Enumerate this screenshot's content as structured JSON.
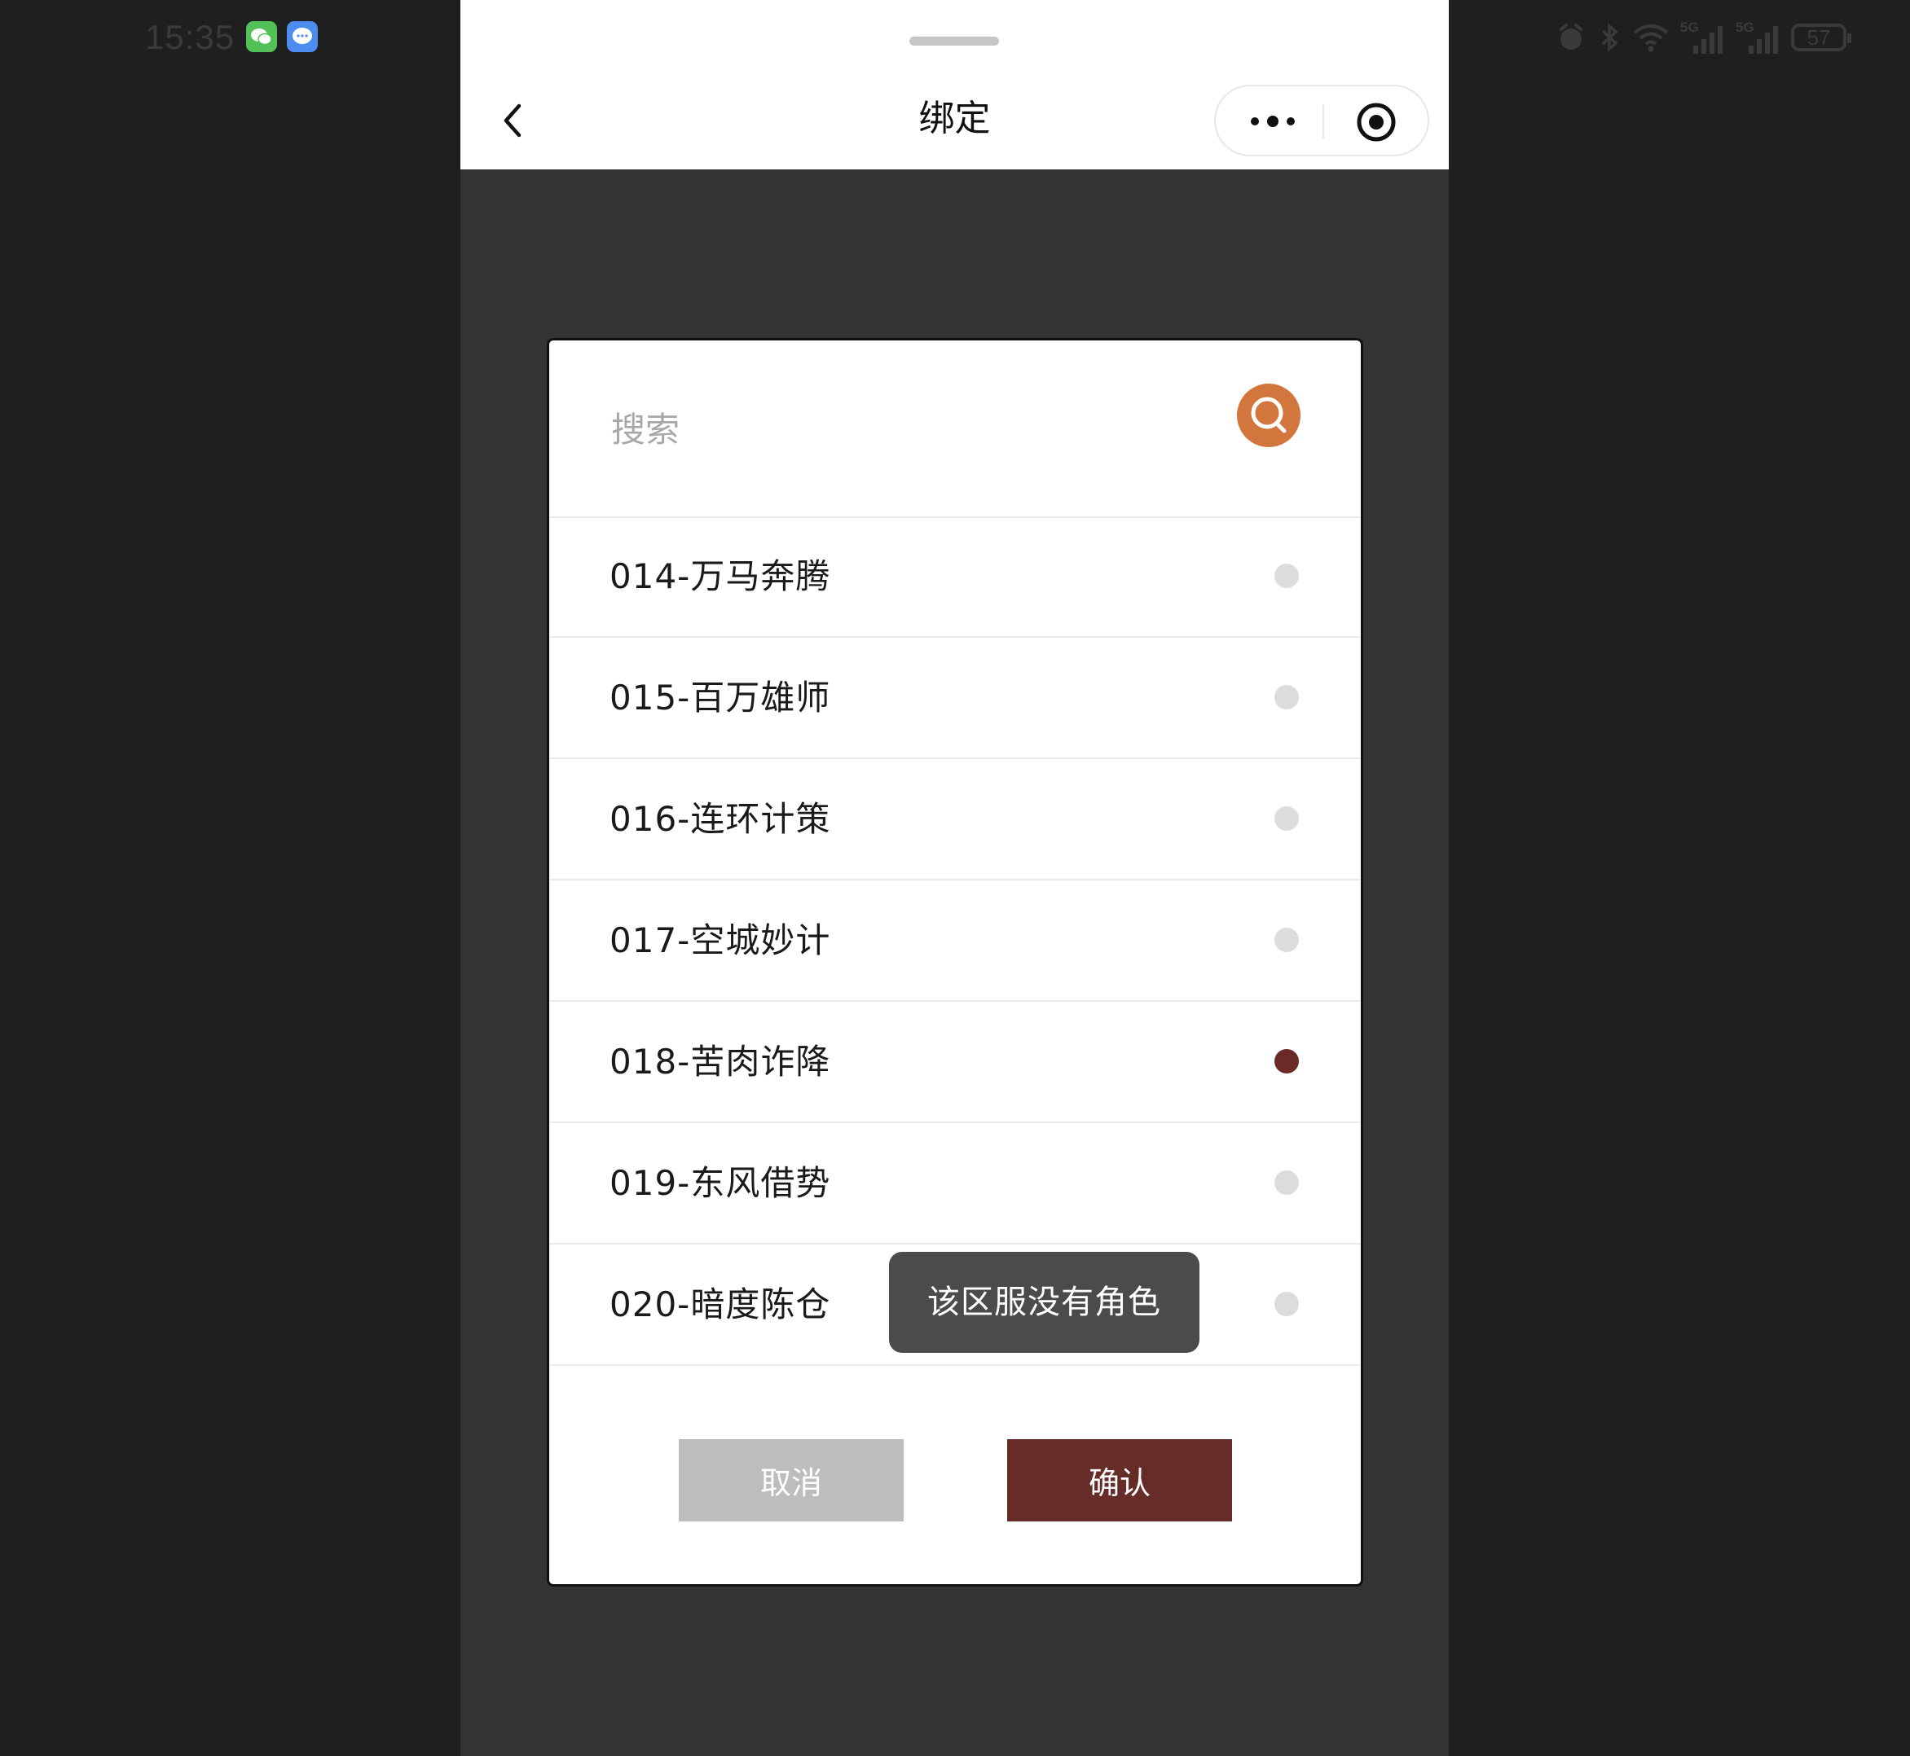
{
  "status_bar": {
    "time": "15:35",
    "notification_icons": [
      "wechat-icon",
      "message-icon"
    ],
    "signal_labels": [
      "5G",
      "5G"
    ],
    "battery": "57"
  },
  "header": {
    "title": "绑定",
    "icons": [
      "back-icon",
      "more-icon",
      "close-target-icon"
    ]
  },
  "dialog": {
    "search": {
      "placeholder": "搜索",
      "value": ""
    },
    "items": [
      {
        "label": "014-万马奔腾",
        "selected": false
      },
      {
        "label": "015-百万雄师",
        "selected": false
      },
      {
        "label": "016-连环计策",
        "selected": false
      },
      {
        "label": "017-空城妙计",
        "selected": false
      },
      {
        "label": "018-苦肉诈降",
        "selected": true
      },
      {
        "label": "019-东风借势",
        "selected": false
      },
      {
        "label": "020-暗度陈仓",
        "selected": false
      }
    ],
    "cancel_label": "取消",
    "confirm_label": "确认"
  },
  "toast": {
    "message": "该区服没有角色"
  },
  "colors": {
    "accent_search": "#d2763d",
    "primary_button": "#662d28",
    "radio_selected": "#6a2a26",
    "radio_unselected": "#dcdcdc",
    "cancel_button": "#bdbdbd"
  }
}
